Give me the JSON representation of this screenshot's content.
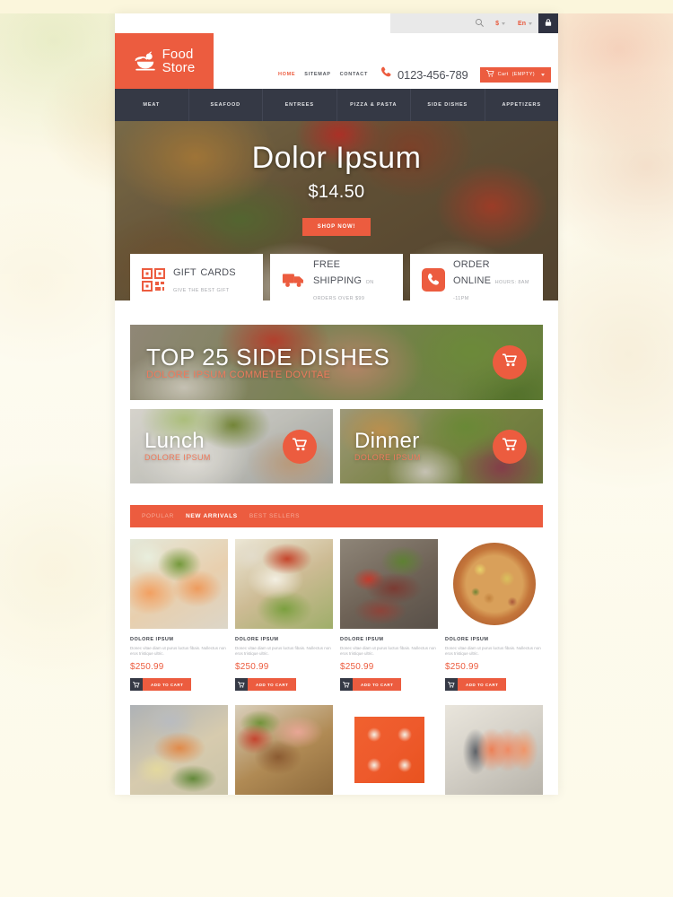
{
  "topbar": {
    "search_placeholder": "",
    "search_value": "",
    "search_icon": "search-icon",
    "currency": "$",
    "language": "En",
    "lock_icon": "lock-icon"
  },
  "header": {
    "logo_line1": "Food",
    "logo_line2": "Store",
    "logo_icon": "bowl-fruit-icon",
    "links": [
      {
        "label": "HOME",
        "active": true
      },
      {
        "label": "SITEMAP",
        "active": false
      },
      {
        "label": "CONTACT",
        "active": false
      }
    ],
    "phone_icon": "phone-icon",
    "phone": "0123-456-789",
    "cart_icon": "cart-icon",
    "cart_label": "Cart",
    "cart_state": "(EMPTY)"
  },
  "nav": {
    "items": [
      {
        "label": "MEAT"
      },
      {
        "label": "SEAFOOD"
      },
      {
        "label": "ENTREES"
      },
      {
        "label": "PIZZA & PASTA"
      },
      {
        "label": "SIDE DISHES"
      },
      {
        "label": "APPETIZERS"
      }
    ]
  },
  "hero": {
    "title": "Dolor Ipsum",
    "price": "$14.50",
    "cta": "SHOP NOW!",
    "slides": 3,
    "active_slide": 1
  },
  "features": [
    {
      "icon": "qr-code-icon",
      "line1": "GIFT",
      "line2": "CARDS",
      "sub": "GIVE THE BEST GIFT"
    },
    {
      "icon": "truck-icon",
      "line1": "FREE",
      "line2": "SHIPPING",
      "sub": "ON ORDERS OVER $99"
    },
    {
      "icon": "phone-square-icon",
      "line1": "ORDER",
      "line2": "ONLINE",
      "sub": "HOURS: 8AM -11PM"
    }
  ],
  "promos": {
    "wide": {
      "title": "TOP 25 SIDE DISHES",
      "sub": "DOLORE IPSUM COMMETE DOVITAE",
      "cart_icon": "cart-icon"
    },
    "lunch": {
      "title": "Lunch",
      "sub": "DOLORE IPSUM",
      "cart_icon": "cart-icon"
    },
    "dinner": {
      "title": "Dinner",
      "sub": "DOLORE IPSUM",
      "cart_icon": "cart-icon"
    }
  },
  "tabs": [
    {
      "label": "POPULAR",
      "active": false
    },
    {
      "label": "NEW ARRIVALS",
      "active": true
    },
    {
      "label": "BEST SELLERS",
      "active": false
    }
  ],
  "products": {
    "add_to_cart_label": "ADD TO CART",
    "add_to_cart_icon": "cart-icon",
    "row1": [
      {
        "image": "salmon-melon-salad",
        "name": "DOLORE IPSUM",
        "desc": "Donec vitae diam ut purus luctus fibais. Nullectus non eros tristique ultric.",
        "price": "$250.99"
      },
      {
        "image": "fish-fillet-salad",
        "name": "DOLORE IPSUM",
        "desc": "Donec vitae diam ut purus luctus fibais. Nullectus non eros tristique ultric.",
        "price": "$250.99"
      },
      {
        "image": "grilled-steak",
        "name": "DOLORE IPSUM",
        "desc": "Donec vitae diam ut purus luctus fibais. Nullectus non eros tristique ultric.",
        "price": "$250.99"
      },
      {
        "image": "pizza",
        "name": "DOLORE IPSUM",
        "desc": "Donec vitae diam ut purus luctus fibais. Nullectus non eros tristique ultric.",
        "price": "$250.99"
      }
    ],
    "row2": [
      {
        "image": "grilled-salmon-rice"
      },
      {
        "image": "roast-chicken-rice"
      },
      {
        "image": "sushi-rolls"
      },
      {
        "image": "salmon-fillet-slices"
      }
    ]
  },
  "colors": {
    "accent": "#ec5c3f",
    "dark": "#353945",
    "page_background": "#fbf6dc",
    "muted_text": "#adafb4"
  }
}
